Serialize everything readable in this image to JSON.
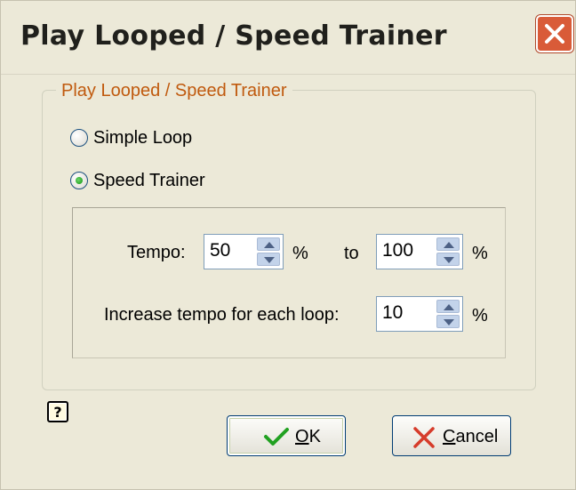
{
  "window": {
    "title": "Play Looped / Speed Trainer",
    "close_icon": "close-icon"
  },
  "group": {
    "legend": "Play Looped / Speed Trainer",
    "options": [
      {
        "label": "Simple Loop",
        "checked": false
      },
      {
        "label": "Speed Trainer",
        "checked": true
      }
    ]
  },
  "trainer": {
    "tempo_label": "Tempo:",
    "tempo_from": "50",
    "from_unit": "%",
    "to_label": "to",
    "tempo_to": "100",
    "to_unit": "%",
    "increase_label": "Increase tempo for each loop:",
    "increase_value": "10",
    "increase_unit": "%"
  },
  "buttons": {
    "ok_mnemonic": "O",
    "ok_rest": "K",
    "cancel_mnemonic": "C",
    "cancel_rest": "ancel"
  },
  "help_icon": "help-icon",
  "colors": {
    "background": "#ece9d8",
    "legend_text": "#c05a0e",
    "close_button": "#d95b38",
    "spin_button": "#c3d3ea",
    "radio_checked": "#21a121"
  }
}
